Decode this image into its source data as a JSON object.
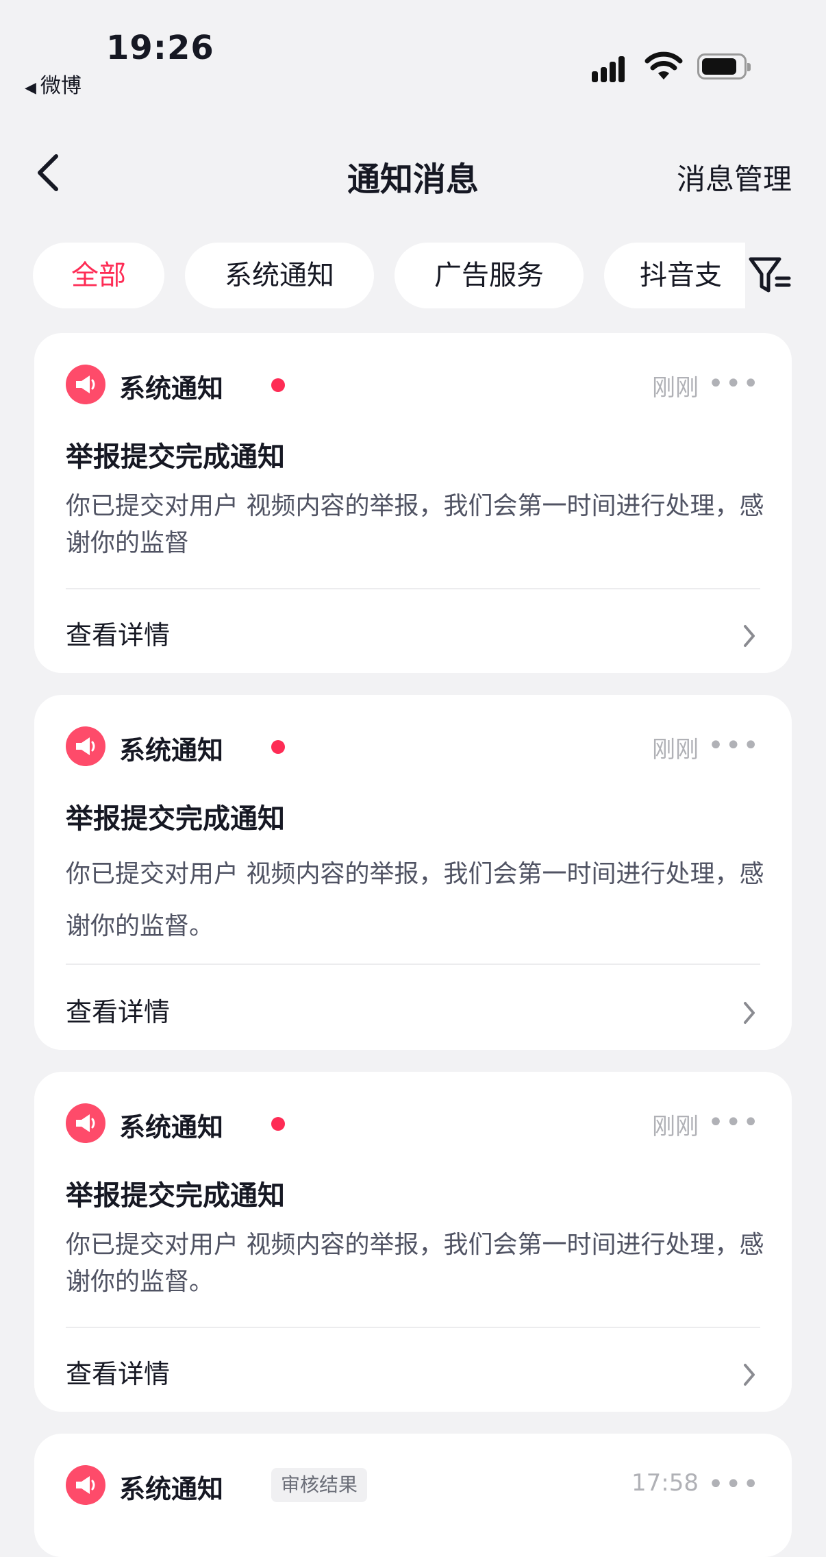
{
  "status_bar": {
    "time": "19:26",
    "back_app": "微博"
  },
  "nav": {
    "title": "通知消息",
    "manage": "消息管理"
  },
  "tabs": [
    {
      "label": "全部",
      "active": true
    },
    {
      "label": "系统通知",
      "active": false
    },
    {
      "label": "广告服务",
      "active": false
    },
    {
      "label": "抖音支",
      "active": false
    }
  ],
  "cards": [
    {
      "source": "系统通知",
      "unread": true,
      "time": "刚刚",
      "title": "举报提交完成通知",
      "body": "你已提交对用户 视频内容的举报，我们会第一时间进行处理，感谢你的监督",
      "detail": "查看详情"
    },
    {
      "source": "系统通知",
      "unread": true,
      "time": "刚刚",
      "title": "举报提交完成通知",
      "body": "你已提交对用户 视频内容的举报，我们会第一时间进行处理，感谢你的监督。",
      "detail": "查看详情"
    },
    {
      "source": "系统通知",
      "unread": true,
      "time": "刚刚",
      "title": "举报提交完成通知",
      "body": "你已提交对用户 视频内容的举报，我们会第一时间进行处理，感谢你的监督。",
      "detail": "查看详情"
    },
    {
      "source": "系统通知",
      "tag": "审核结果",
      "time": "17:58"
    }
  ],
  "colors": {
    "accent": "#fe2c55",
    "source_icon": "#fe4b6a",
    "background": "#f2f2f4"
  },
  "icons": [
    "back-chevron-icon",
    "filter-icon",
    "megaphone-icon",
    "more-icon",
    "chevron-right-icon",
    "signal-icon",
    "wifi-icon",
    "battery-icon"
  ]
}
